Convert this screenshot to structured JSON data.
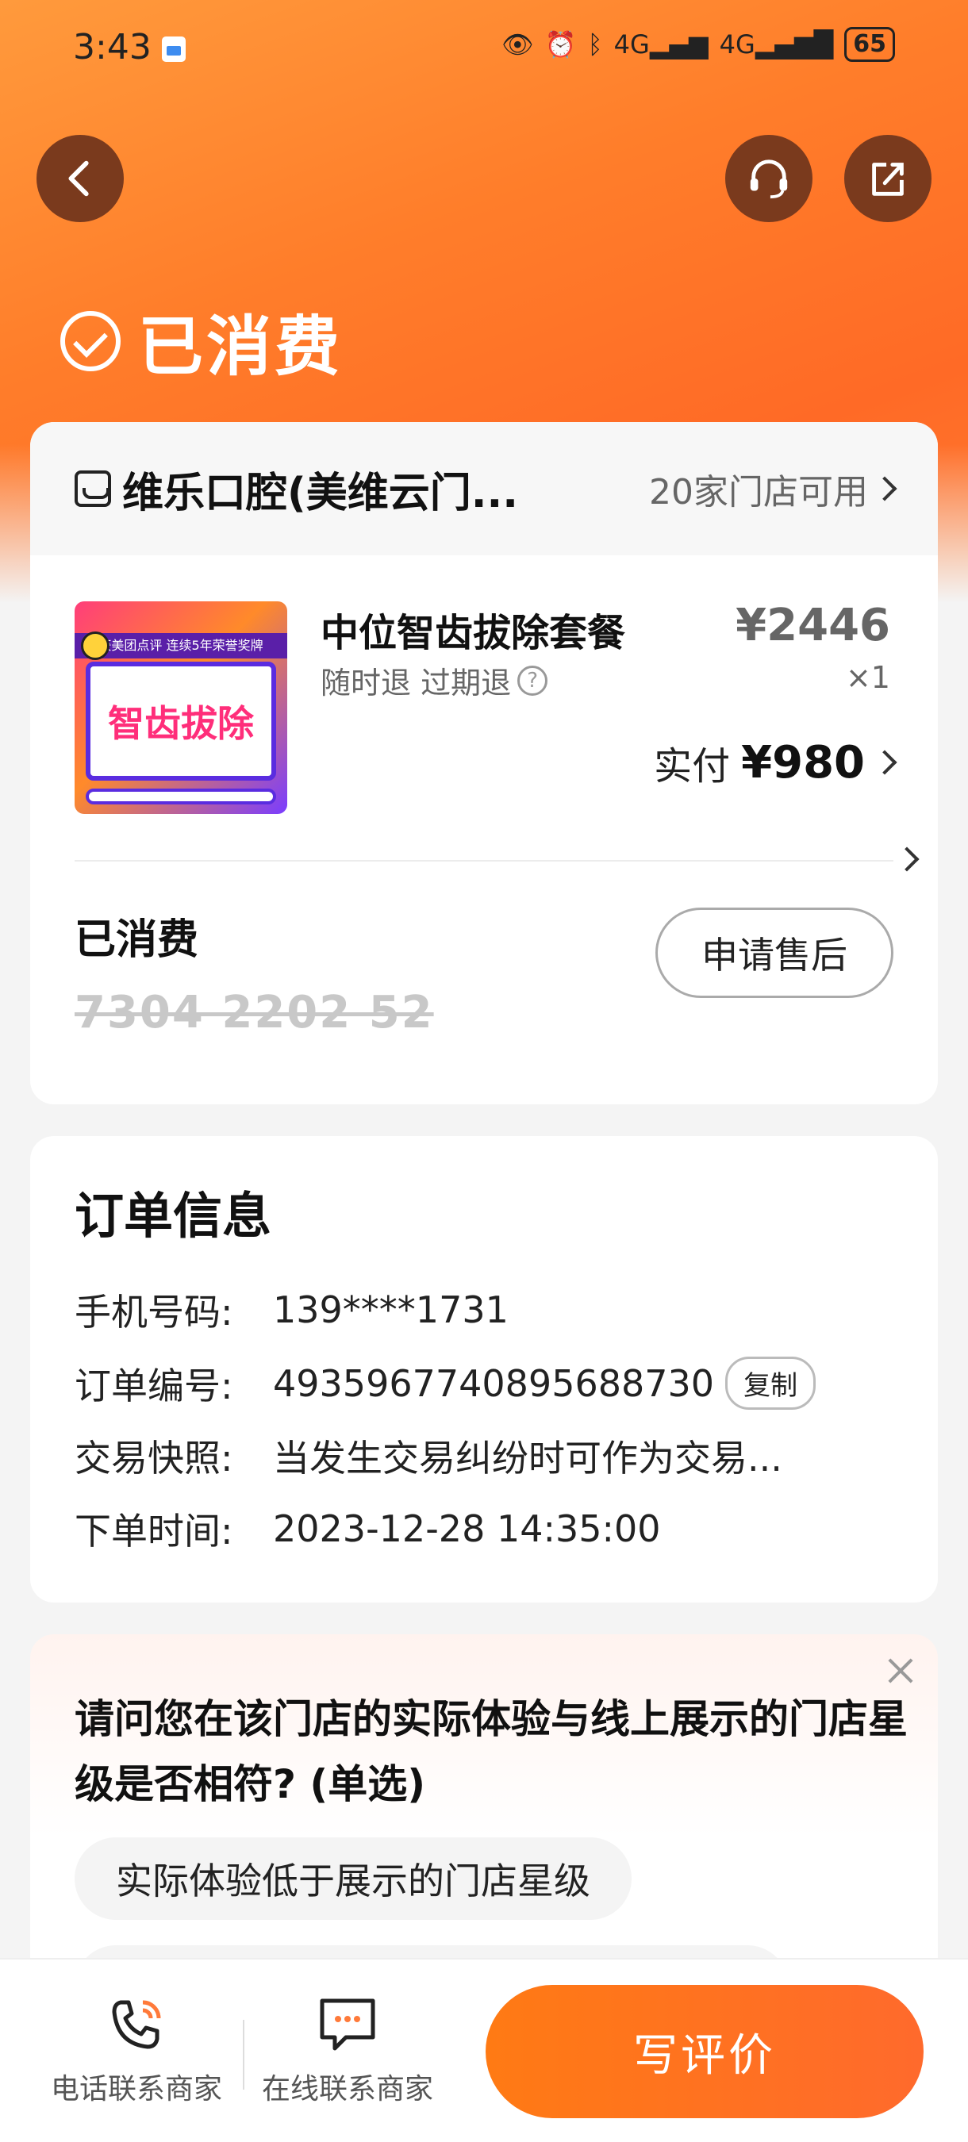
{
  "status_bar": {
    "time": "3:43",
    "network1": "4G",
    "network2": "4G",
    "battery": "65"
  },
  "header": {
    "status_title": "已消费"
  },
  "store": {
    "name": "维乐口腔(美维云门...",
    "available": "20家门店可用"
  },
  "product": {
    "name": "中位智齿拔除套餐",
    "refund_policy": "随时退 过期退",
    "price": "¥2446",
    "quantity": "×1",
    "paid_label": "实付",
    "paid_amount": "¥980",
    "image_banner": "获美团点评 连续5年荣誉奖牌",
    "image_title": "智齿拔除"
  },
  "coupon": {
    "status": "已消费",
    "code": "7304 2202 52",
    "after_sale_label": "申请售后"
  },
  "order": {
    "title": "订单信息",
    "phone_label": "手机号码:",
    "phone_value": "139****1731",
    "order_no_label": "订单编号:",
    "order_no_value": "4935967740895688730",
    "copy_label": "复制",
    "snapshot_label": "交易快照:",
    "snapshot_value": "当发生交易纠纷时可作为交易...",
    "time_label": "下单时间:",
    "time_value": "2023-12-28 14:35:00"
  },
  "survey": {
    "question": "请问您在该门店的实际体验与线上展示的门店星级是否相符? (单选)",
    "option1": "实际体验低于展示的门店星级"
  },
  "bottom_bar": {
    "phone_label": "电话联系商家",
    "chat_label": "在线联系商家",
    "review_label": "写评价"
  },
  "colors": {
    "accent": "#ff7a14",
    "hero": "#ff7d2a",
    "icon_bg": "#7a3a1d"
  }
}
